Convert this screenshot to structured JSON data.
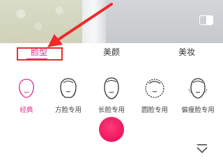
{
  "preview": {
    "toggle_icon": "compare-toggle-icon"
  },
  "tabs": {
    "face_shape": "脸型",
    "beauty": "美颜",
    "makeup": "美妆"
  },
  "face_shapes": [
    {
      "label": "经典",
      "icon": "classic-face-icon",
      "selected": true
    },
    {
      "label": "方脸专用",
      "icon": "square-face-icon",
      "selected": false
    },
    {
      "label": "长脸专用",
      "icon": "long-face-icon",
      "selected": false
    },
    {
      "label": "圆脸专用",
      "icon": "round-face-icon",
      "selected": false
    },
    {
      "label": "偏瘦脸专用",
      "icon": "thin-face-icon",
      "selected": false
    }
  ],
  "colors": {
    "accent": "#e2288e",
    "annotation_red": "#ee2a2a",
    "shutter": "#f0155c"
  },
  "bottom": {
    "shutter_icon": "shutter-button",
    "collapse_icon": "chevron-down-icon"
  }
}
